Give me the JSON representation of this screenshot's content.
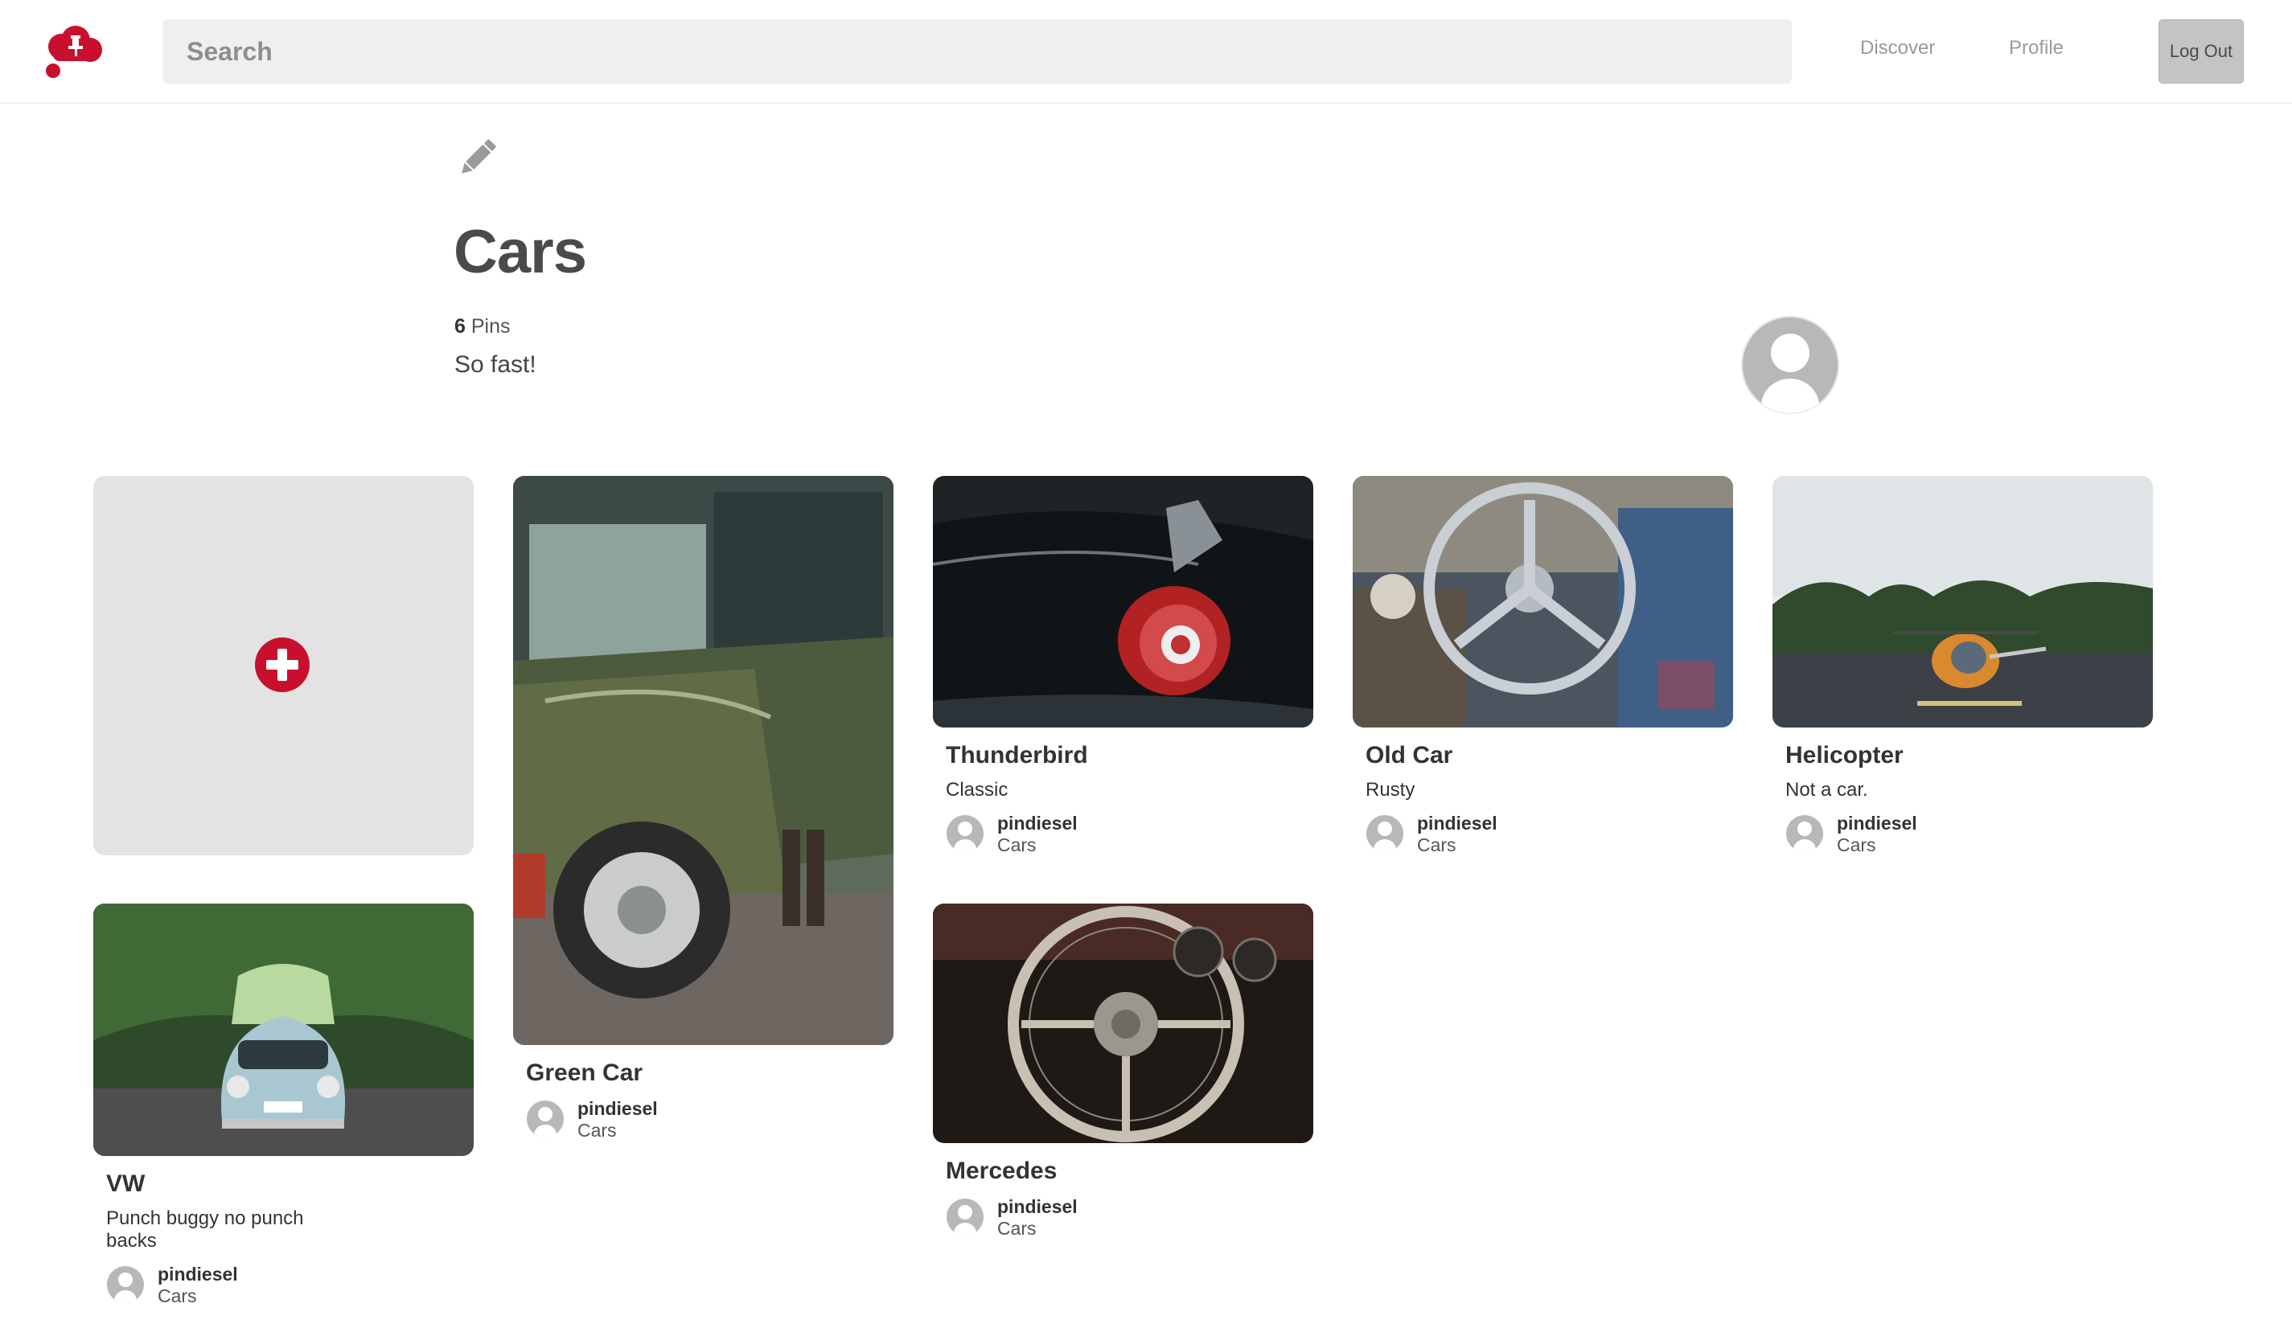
{
  "header": {
    "search_placeholder": "Search",
    "nav_discover": "Discover",
    "nav_profile": "Profile",
    "logout_label": "Log Out",
    "logo_icon": "cloud-pin-logo-icon",
    "brand_color": "#c8102e"
  },
  "board": {
    "edit_icon": "pencil-icon",
    "title": "Cars",
    "pin_count": "6",
    "pins_label": "Pins",
    "description": "So fast!",
    "owner_avatar_icon": "default-avatar-icon"
  },
  "add_pin": {
    "icon": "plus-circle-icon"
  },
  "pins": [
    {
      "title": "Green Car",
      "description": "",
      "user": "pindiesel",
      "board": "Cars",
      "image": "green classic car photo"
    },
    {
      "title": "Thunderbird",
      "description": "Classic",
      "user": "pindiesel",
      "board": "Cars",
      "image": "thunderbird tail light photo"
    },
    {
      "title": "Old Car",
      "description": "Rusty",
      "user": "pindiesel",
      "board": "Cars",
      "image": "rusty steering wheel photo"
    },
    {
      "title": "Helicopter",
      "description": "Not a car.",
      "user": "pindiesel",
      "board": "Cars",
      "image": "helicopter photo"
    },
    {
      "title": "VW",
      "description": "Punch buggy no punch backs",
      "user": "pindiesel",
      "board": "Cars",
      "image": "vw beetle photo"
    },
    {
      "title": "Mercedes",
      "description": "",
      "user": "pindiesel",
      "board": "Cars",
      "image": "mercedes steering wheel photo"
    }
  ]
}
